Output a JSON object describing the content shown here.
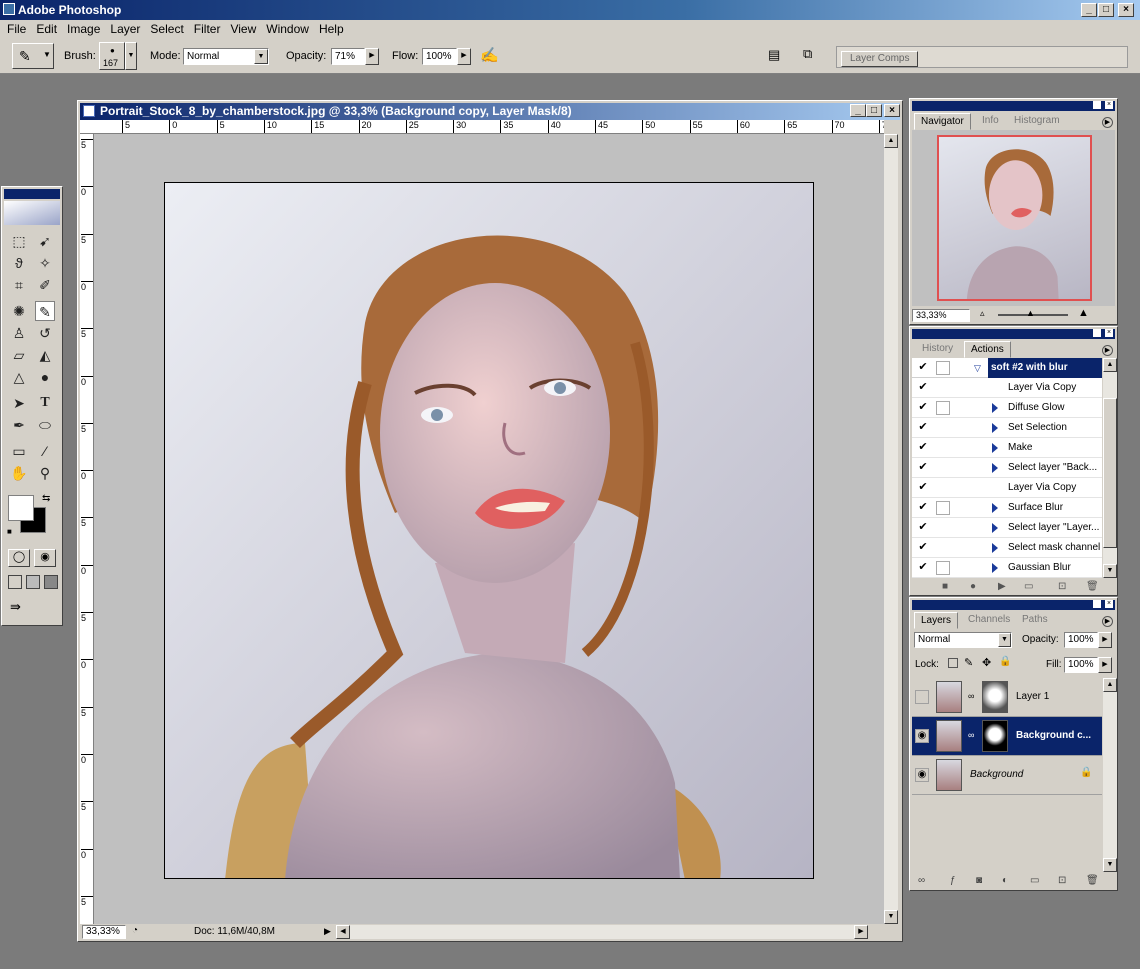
{
  "app": {
    "title": "Adobe Photoshop"
  },
  "menu": [
    "File",
    "Edit",
    "Image",
    "Layer",
    "Select",
    "Filter",
    "View",
    "Window",
    "Help"
  ],
  "options": {
    "brush_label": "Brush:",
    "brush_size": "167",
    "mode_label": "Mode:",
    "mode_value": "Normal",
    "opacity_label": "Opacity:",
    "opacity_value": "71%",
    "flow_label": "Flow:",
    "flow_value": "100%",
    "layer_comps": "Layer Comps"
  },
  "document": {
    "title": "Portrait_Stock_8_by_chamberstock.jpg @ 33,3% (Background copy, Layer Mask/8)",
    "ruler_h": [
      "5",
      "0",
      "5",
      "10",
      "15",
      "20",
      "25",
      "30",
      "35",
      "40",
      "45",
      "50",
      "55",
      "60",
      "65",
      "70",
      "75"
    ],
    "ruler_v": [
      "5",
      "0",
      "5",
      "0",
      "5",
      "0",
      "5",
      "0",
      "5",
      "0",
      "5",
      "0",
      "5",
      "0",
      "5",
      "0",
      "5",
      "0"
    ],
    "zoom": "33,33%",
    "doc_size": "Doc: 11,6M/40,8M"
  },
  "navigator": {
    "tabs": [
      "Navigator",
      "Info",
      "Histogram"
    ],
    "zoom": "33,33%"
  },
  "actions": {
    "tabs": [
      "History",
      "Actions"
    ],
    "set_name": "soft #2 with blur",
    "items": [
      {
        "label": "Layer Via Copy",
        "expand": false,
        "dialog": false
      },
      {
        "label": "Diffuse Glow",
        "expand": true,
        "dialog": true
      },
      {
        "label": "Set Selection",
        "expand": true,
        "dialog": false
      },
      {
        "label": "Make",
        "expand": true,
        "dialog": false
      },
      {
        "label": "Select layer \"Back...",
        "expand": true,
        "dialog": false
      },
      {
        "label": "Layer Via Copy",
        "expand": false,
        "dialog": false
      },
      {
        "label": "Surface Blur",
        "expand": true,
        "dialog": true
      },
      {
        "label": "Select layer \"Layer...",
        "expand": true,
        "dialog": false
      },
      {
        "label": "Select mask channel",
        "expand": true,
        "dialog": false
      },
      {
        "label": "Gaussian Blur",
        "expand": true,
        "dialog": true
      }
    ]
  },
  "layers": {
    "tabs": [
      "Layers",
      "Channels",
      "Paths"
    ],
    "blend_mode": "Normal",
    "opacity_label": "Opacity:",
    "opacity_value": "100%",
    "lock_label": "Lock:",
    "fill_label": "Fill:",
    "fill_value": "100%",
    "items": [
      {
        "name": "Layer 1",
        "visible": false,
        "selected": false
      },
      {
        "name": "Background c...",
        "visible": true,
        "selected": true
      },
      {
        "name": "Background",
        "visible": true,
        "selected": false
      }
    ]
  },
  "colors": {
    "title_bar": "#0a246a",
    "panel_bg": "#d4d0c8",
    "selected_layer": "#0a246a",
    "navigator_frame": "#e05050"
  }
}
